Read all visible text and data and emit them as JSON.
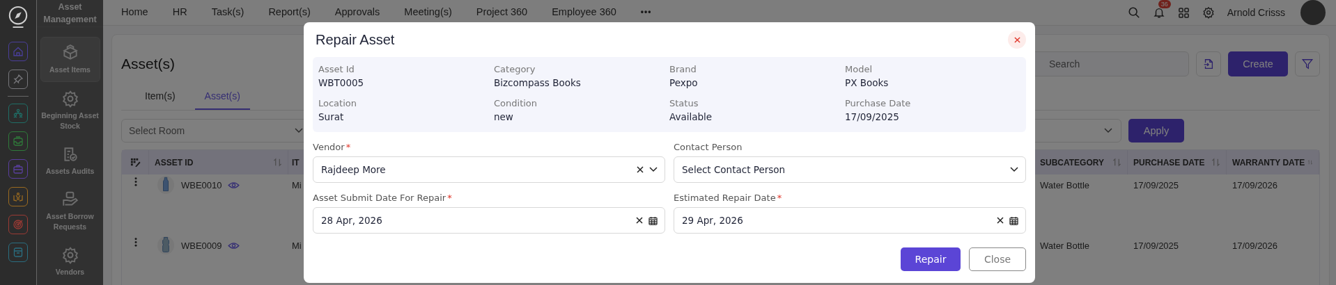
{
  "rail": {
    "items": [
      {
        "kind": "home",
        "color": "#4a3f9a"
      },
      {
        "kind": "pin",
        "color": "#77777b"
      },
      {
        "kind": "sitemap",
        "color": "#1f6e66"
      },
      {
        "kind": "inbox",
        "color": "#2f7a3a"
      },
      {
        "kind": "briefcase",
        "color": "#5a3f9e"
      },
      {
        "kind": "hand",
        "color": "#9a6a20"
      },
      {
        "kind": "target",
        "color": "#9a3a34"
      },
      {
        "kind": "archive",
        "color": "#2a6e80"
      }
    ]
  },
  "app_title": "Asset Management",
  "sidebar": {
    "items": [
      {
        "label": "Asset Items",
        "kind": "box",
        "selected": true
      },
      {
        "label": "Beginning Asset Stock",
        "kind": "gear",
        "selected": false
      },
      {
        "label": "Assets Audits",
        "kind": "audit",
        "selected": false
      },
      {
        "label": "Asset Borrow Requests",
        "kind": "borrow",
        "selected": false
      },
      {
        "label": "Vendors",
        "kind": "gear",
        "selected": false
      }
    ]
  },
  "nav": {
    "items": [
      "Home",
      "HR",
      "Task(s)",
      "Report(s)",
      "Approvals",
      "Meeting(s)",
      "Project 360",
      "Employee 360"
    ],
    "more": "•••"
  },
  "header": {
    "notification_count": "36",
    "user_name": "Arnold Crisss"
  },
  "page": {
    "title": "Asset(s)",
    "tabs": [
      {
        "label": "Item(s)",
        "selected": false
      },
      {
        "label": "Asset(s)",
        "selected": true
      }
    ],
    "room_select": {
      "placeholder": "Select Room"
    },
    "search": {
      "placeholder": "Search"
    },
    "create_label": "Create",
    "apply_label": "Apply"
  },
  "table": {
    "columns": [
      {
        "label": "ASSET ID",
        "sortable": true
      },
      {
        "label": "IT"
      },
      {
        "label": "SUBCATEGORY",
        "sortable": true
      },
      {
        "label": "PURCHASE DATE",
        "sortable": true
      },
      {
        "label": "WARRANTY DATE",
        "sortable": true
      }
    ],
    "rows": [
      {
        "asset_id": "WBE0010",
        "column_2": "Mi",
        "subcategory": "Water Bottle",
        "purchase_date": "17/09/2025",
        "warranty_date": "17/09/2026",
        "kind": "slim"
      },
      {
        "asset_id": "WBE0009",
        "column_2": "Mi",
        "subcategory": "Water Bottle",
        "purchase_date": "17/09/2025",
        "warranty_date": "17/09/2026",
        "kind": "jug"
      }
    ]
  },
  "modal": {
    "title": "Repair Asset",
    "details": [
      {
        "label": "Asset Id",
        "value": "WBT0005"
      },
      {
        "label": "Category",
        "value": "Bizcompass Books"
      },
      {
        "label": "Brand",
        "value": "Pexpo"
      },
      {
        "label": "Model",
        "value": "PX Books"
      },
      {
        "label": "Location",
        "value": "Surat"
      },
      {
        "label": "Condition",
        "value": "new"
      },
      {
        "label": "Status",
        "value": "Available"
      },
      {
        "label": "Purchase Date",
        "value": "17/09/2025"
      }
    ],
    "fields": [
      {
        "label": "Vendor",
        "required_mark": "*",
        "kind": "select",
        "value": "Rajdeep More"
      },
      {
        "label": "Contact Person",
        "kind": "select",
        "placeholder": "Select Contact Person"
      },
      {
        "label": "Asset Submit Date For Repair",
        "required_mark": "*",
        "kind": "date",
        "value": "28 Apr, 2026"
      },
      {
        "label": "Estimated Repair Date",
        "required_mark": "*",
        "kind": "date",
        "value": "29 Apr, 2026"
      }
    ],
    "buttons": [
      {
        "label": "Repair",
        "kind": "primary"
      },
      {
        "label": "Close",
        "kind": "secondary"
      }
    ]
  }
}
